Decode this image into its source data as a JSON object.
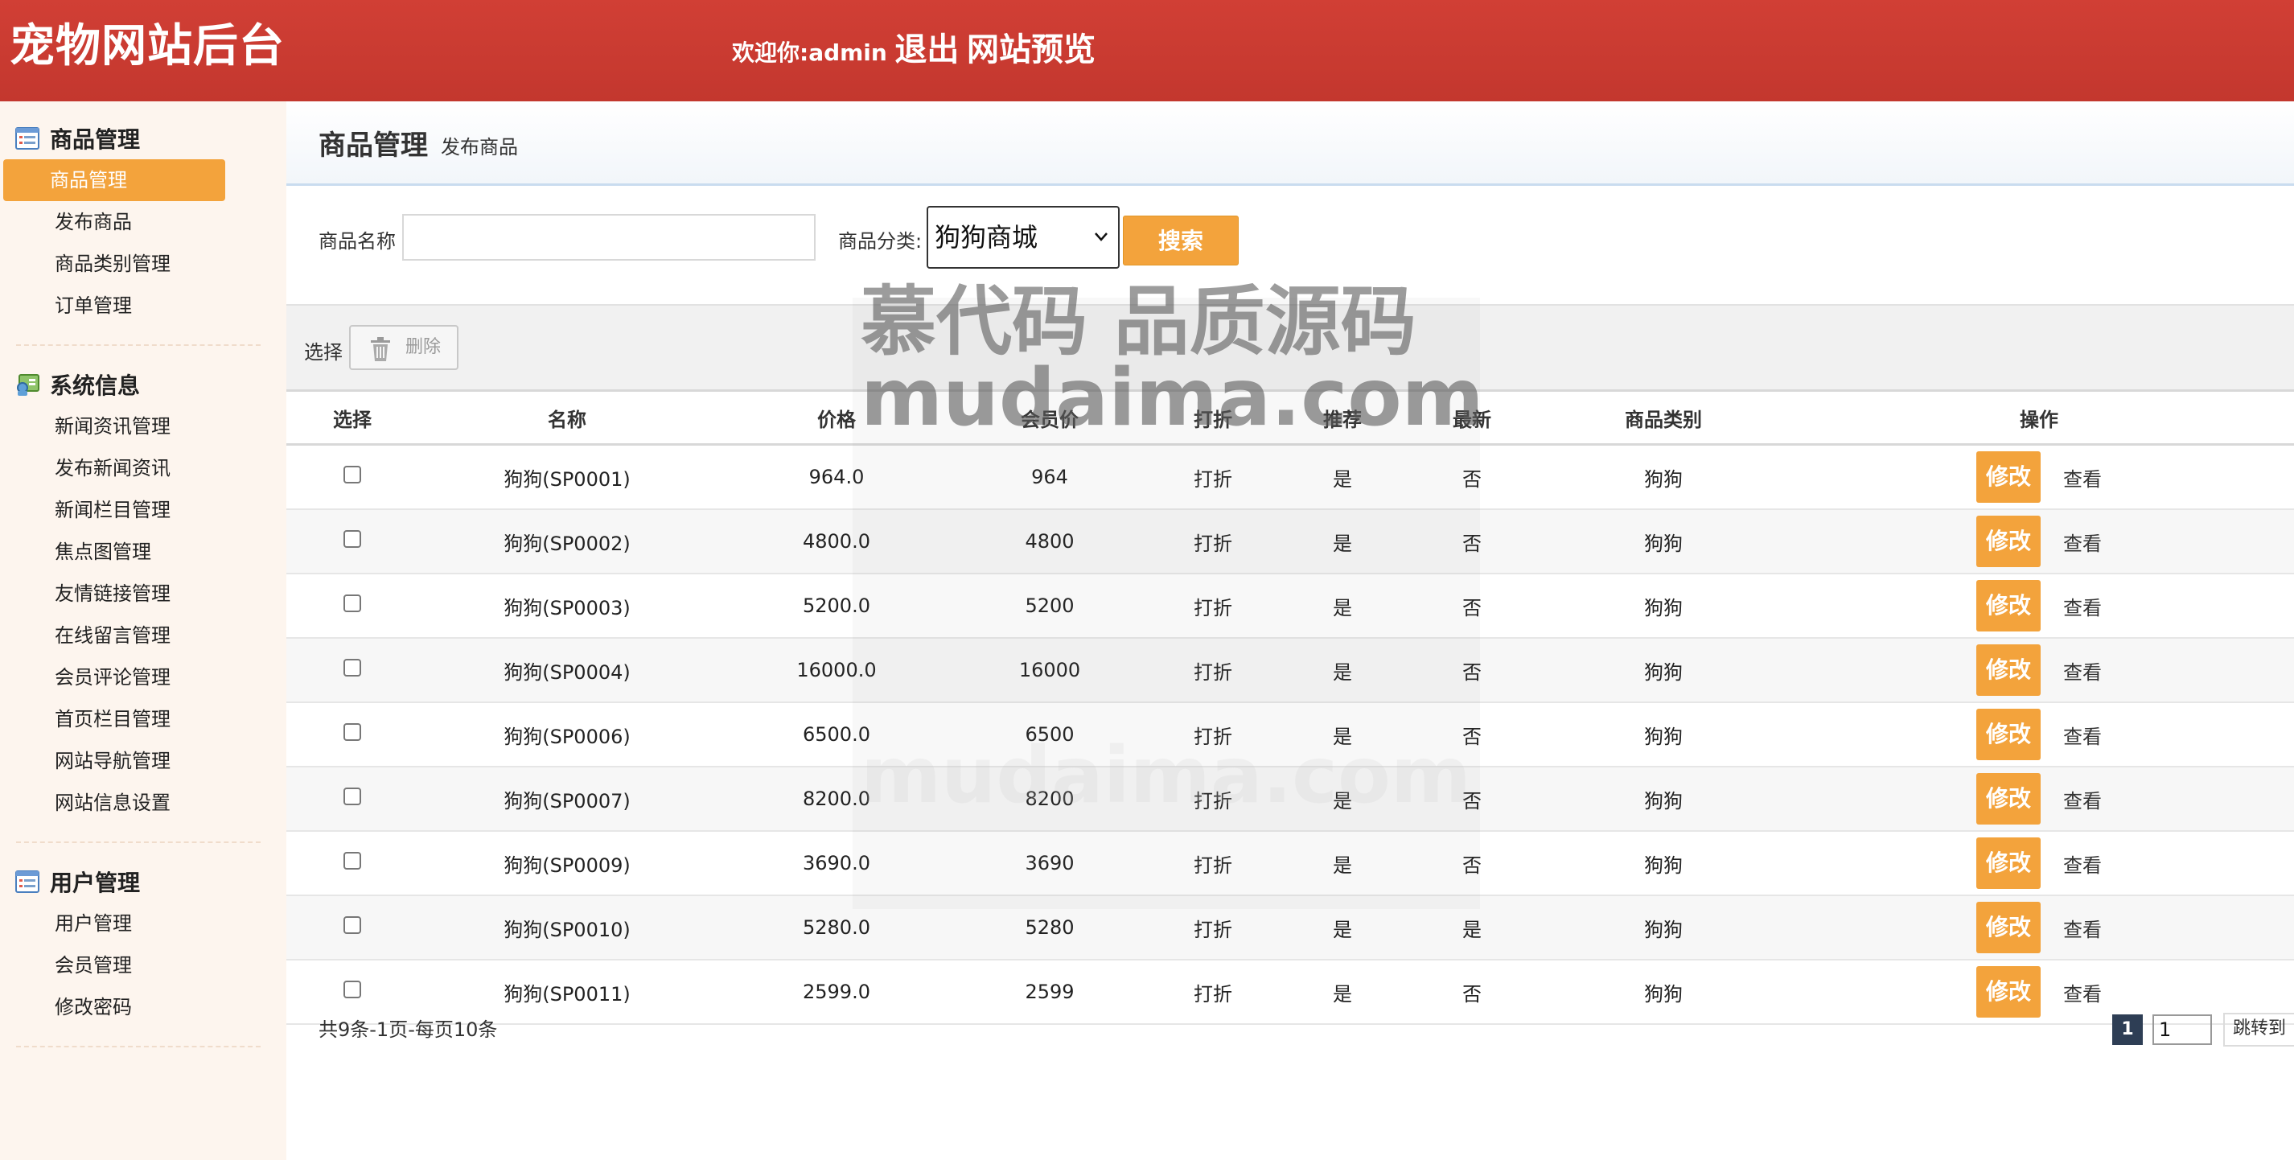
{
  "header": {
    "brand": "宠物网站后台",
    "welcome": "欢迎你:admin",
    "logout": "退出",
    "preview": "网站预览"
  },
  "sidebar": {
    "groups": [
      {
        "title": "商品管理",
        "icon": "product-list-icon",
        "items": [
          "商品管理",
          "发布商品",
          "商品类别管理",
          "订单管理"
        ]
      },
      {
        "title": "系统信息",
        "icon": "system-info-icon",
        "items": [
          "新闻资讯管理",
          "发布新闻资讯",
          "新闻栏目管理",
          "焦点图管理",
          "友情链接管理",
          "在线留言管理",
          "会员评论管理",
          "首页栏目管理",
          "网站导航管理",
          "网站信息设置"
        ]
      },
      {
        "title": "用户管理",
        "icon": "user-list-icon",
        "items": [
          "用户管理",
          "会员管理",
          "修改密码"
        ]
      }
    ],
    "active": "商品管理"
  },
  "main": {
    "title": "商品管理",
    "subtitle": "发布商品",
    "search": {
      "name_label": "商品名称",
      "name_value": "",
      "category_label": "商品分类:",
      "category_value": "狗狗商城",
      "button": "搜索"
    },
    "toolbar": {
      "select_label": "选择",
      "delete_label": "删除"
    },
    "table": {
      "columns": [
        "选择",
        "名称",
        "价格",
        "会员价",
        "打折",
        "推荐",
        "最新",
        "商品类别",
        "操作"
      ],
      "rows": [
        {
          "name": "狗狗(SP0001)",
          "price": "964.0",
          "member_price": "964",
          "discount": "打折",
          "recommend": "是",
          "newest": "否",
          "category": "狗狗"
        },
        {
          "name": "狗狗(SP0002)",
          "price": "4800.0",
          "member_price": "4800",
          "discount": "打折",
          "recommend": "是",
          "newest": "否",
          "category": "狗狗"
        },
        {
          "name": "狗狗(SP0003)",
          "price": "5200.0",
          "member_price": "5200",
          "discount": "打折",
          "recommend": "是",
          "newest": "否",
          "category": "狗狗"
        },
        {
          "name": "狗狗(SP0004)",
          "price": "16000.0",
          "member_price": "16000",
          "discount": "打折",
          "recommend": "是",
          "newest": "否",
          "category": "狗狗"
        },
        {
          "name": "狗狗(SP0006)",
          "price": "6500.0",
          "member_price": "6500",
          "discount": "打折",
          "recommend": "是",
          "newest": "否",
          "category": "狗狗"
        },
        {
          "name": "狗狗(SP0007)",
          "price": "8200.0",
          "member_price": "8200",
          "discount": "打折",
          "recommend": "是",
          "newest": "否",
          "category": "狗狗"
        },
        {
          "name": "狗狗(SP0009)",
          "price": "3690.0",
          "member_price": "3690",
          "discount": "打折",
          "recommend": "是",
          "newest": "否",
          "category": "狗狗"
        },
        {
          "name": "狗狗(SP0010)",
          "price": "5280.0",
          "member_price": "5280",
          "discount": "打折",
          "recommend": "是",
          "newest": "是",
          "category": "狗狗"
        },
        {
          "name": "狗狗(SP0011)",
          "price": "2599.0",
          "member_price": "2599",
          "discount": "打折",
          "recommend": "是",
          "newest": "否",
          "category": "狗狗"
        }
      ],
      "edit_label": "修改",
      "view_label": "查看"
    },
    "pager": {
      "info": "共9条-1页-每页10条",
      "current": "1",
      "input_value": "1",
      "jump_label": "跳转到"
    }
  },
  "watermark": {
    "line1": "慕代码 品质源码",
    "line2": "mudaima.com",
    "line3": "mudaima.com"
  },
  "colors": {
    "header_bg": "#c93b31",
    "accent": "#f3a33c",
    "sidebar_bg": "#fdf5ee",
    "pager_current": "#2e3e55"
  }
}
